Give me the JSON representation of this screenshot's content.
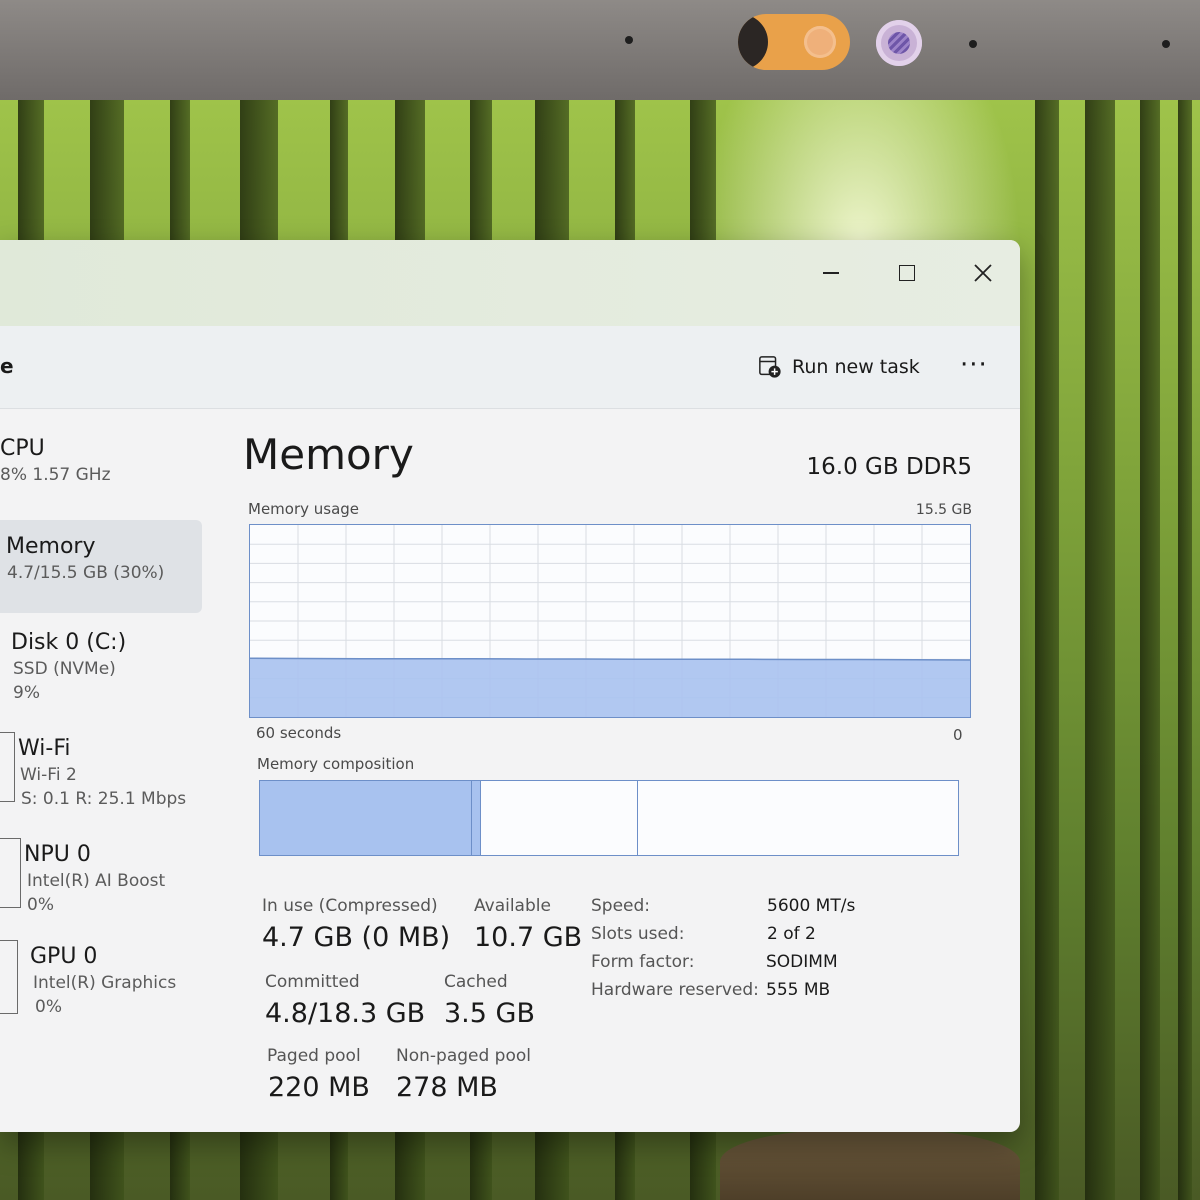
{
  "window": {
    "page_letter": "e",
    "run_new_task_label": "Run new task",
    "more_label": "···"
  },
  "sidebar": {
    "items": [
      {
        "title": "CPU",
        "lines": [
          "8% 1.57 GHz"
        ]
      },
      {
        "title": "Memory",
        "lines": [
          "4.7/15.5 GB (30%)"
        ],
        "active": true
      },
      {
        "title": "Disk 0 (C:)",
        "lines": [
          "SSD (NVMe)",
          "9%"
        ]
      },
      {
        "title": "Wi-Fi",
        "lines": [
          "Wi-Fi 2",
          "S: 0.1 R: 25.1 Mbps"
        ]
      },
      {
        "title": "NPU 0",
        "lines": [
          "Intel(R) AI Boost",
          "0%"
        ]
      },
      {
        "title": "GPU 0",
        "lines": [
          "Intel(R) Graphics",
          "0%"
        ]
      }
    ]
  },
  "memory": {
    "title": "Memory",
    "spec": "16.0 GB DDR5",
    "usage_label": "Memory usage",
    "usage_max": "15.5 GB",
    "time_left": "60 seconds",
    "time_right": "0",
    "composition_label": "Memory composition",
    "stats": {
      "in_use_label": "In use (Compressed)",
      "in_use_value": "4.7 GB (0 MB)",
      "available_label": "Available",
      "available_value": "10.7 GB",
      "committed_label": "Committed",
      "committed_value": "4.8/18.3 GB",
      "cached_label": "Cached",
      "cached_value": "3.5 GB",
      "paged_label": "Paged pool",
      "paged_value": "220 MB",
      "nonpaged_label": "Non-paged pool",
      "nonpaged_value": "278 MB"
    },
    "specs": {
      "speed_label": "Speed:",
      "speed_value": "5600 MT/s",
      "slots_label": "Slots used:",
      "slots_value": "2 of 2",
      "form_label": "Form factor:",
      "form_value": "SODIMM",
      "hw_label": "Hardware reserved:",
      "hw_value": "555 MB"
    }
  },
  "colors": {
    "accent": "#6d8fc8",
    "fill": "#a8c2ef"
  },
  "chart_data": {
    "type": "area",
    "title": "Memory usage",
    "xlabel": "",
    "ylabel": "",
    "x_range_labels": [
      "60 seconds",
      "0"
    ],
    "ylim": [
      0,
      15.5
    ],
    "values_gb": [
      4.75,
      4.72,
      4.7,
      4.7,
      4.7,
      4.68,
      4.68,
      4.66,
      4.66,
      4.66,
      4.64,
      4.64,
      4.62,
      4.6
    ],
    "composition_gb": {
      "in_use": 4.7,
      "modified": 0.2,
      "standby": 3.5,
      "free": 7.1
    },
    "grid": true
  }
}
